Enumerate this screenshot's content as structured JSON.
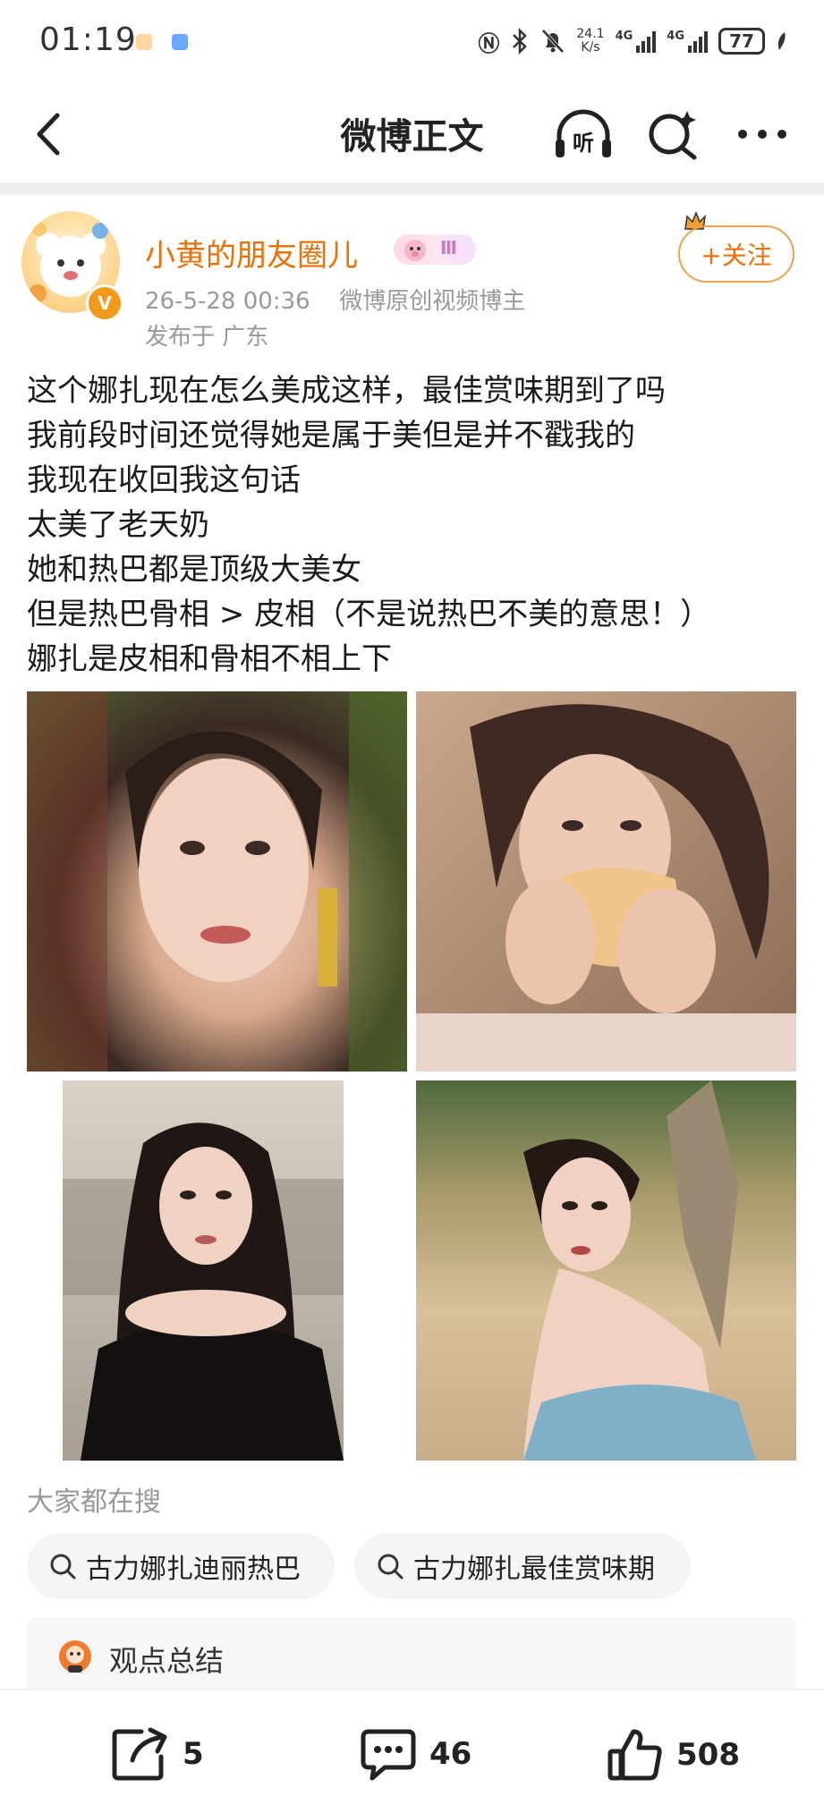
{
  "status_bar": {
    "time": "01:19",
    "net_speed_value": "24.1",
    "net_speed_unit": "K/s",
    "signal_1": "4G",
    "signal_2": "4G",
    "battery": "77"
  },
  "nav": {
    "title": "微博正文",
    "listen_label": "听"
  },
  "post": {
    "author": "小黄的朋友圈儿",
    "badge_level": "Ⅲ",
    "timestamp": "26-5-28 00:36",
    "author_tag": "微博原创视频博主",
    "location": "发布于 广东",
    "follow_label": "+关注",
    "text_lines": [
      "这个娜扎现在怎么美成这样，最佳赏味期到了吗",
      "我前段时间还觉得她是属于美但是并不戳我的",
      "我现在收回我这句话",
      "太美了老天奶",
      "她和热巴都是顶级大美女",
      "但是热巴骨相 > 皮相（不是说热巴不美的意思！）",
      "娜扎是皮相和骨相不相上下"
    ]
  },
  "search": {
    "title": "大家都在搜",
    "chips": [
      "古力娜扎迪丽热巴",
      "古力娜扎最佳赏味期"
    ]
  },
  "summary": {
    "label": "观点总结"
  },
  "actions": {
    "share_count": "5",
    "comment_count": "46",
    "like_count": "508"
  },
  "colors": {
    "accent": "#e8710a",
    "muted": "#999999"
  }
}
